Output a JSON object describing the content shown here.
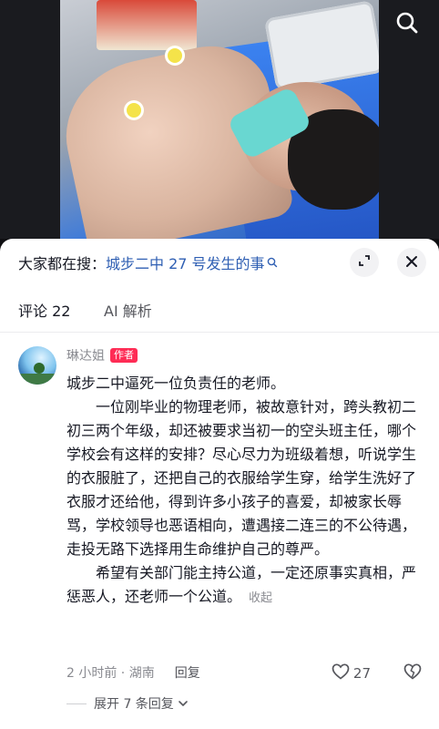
{
  "search_bar": {
    "prefix": "大家都在搜：",
    "term": "城步二中 27 号发生的事"
  },
  "tabs": [
    {
      "label": "评论 22"
    },
    {
      "label": "AI 解析"
    }
  ],
  "comment": {
    "author": "琳达姐",
    "badge": "作者",
    "lines": [
      "城步二中逼死一位负责任的老师。",
      "一位刚毕业的物理老师，被故意针对，跨头教初二初三两个年级，却还被要求当初一的空头班主任，哪个学校会有这样的安排？尽心尽力为班级着想，听说学生的衣服脏了，还把自己的衣服给学生穿，给学生洗好了衣服才还给他，得到许多小孩子的喜爱，却被家长辱骂，学校领导也恶语相向，遭遇接二连三的不公待遇，走投无路下选择用生命维护自己的尊严。",
      "希望有关部门能主持公道，一定还原事实真相，严惩恶人，还老师一个公道。"
    ],
    "collapse_label": "收起",
    "time_location": "2 小时前 · 湖南",
    "reply_label": "回复",
    "likes": "27",
    "expand_label": "展开 7 条回复"
  },
  "colors": {
    "accent_red": "#fe2c55",
    "link_blue": "#2f5fb3"
  },
  "icons": {
    "video_search": "search-icon",
    "fullscreen": "expand-icon",
    "close": "close-icon",
    "like": "heart-icon",
    "dislike": "broken-heart-icon",
    "expand_chevron": "chevron-down-icon"
  }
}
